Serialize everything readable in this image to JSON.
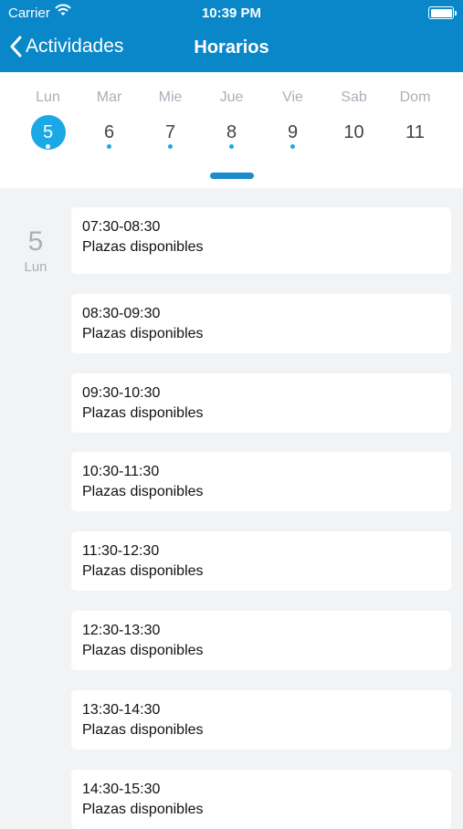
{
  "status": {
    "carrier": "Carrier",
    "time": "10:39 PM"
  },
  "nav": {
    "back_label": "Actividades",
    "title": "Horarios"
  },
  "week": {
    "accent": "#1aa9e6",
    "days": [
      {
        "name": "Lun",
        "num": "5",
        "selected": true,
        "dot": true
      },
      {
        "name": "Mar",
        "num": "6",
        "selected": false,
        "dot": true
      },
      {
        "name": "Mie",
        "num": "7",
        "selected": false,
        "dot": true
      },
      {
        "name": "Jue",
        "num": "8",
        "selected": false,
        "dot": true
      },
      {
        "name": "Vie",
        "num": "9",
        "selected": false,
        "dot": true
      },
      {
        "name": "Sab",
        "num": "10",
        "selected": false,
        "dot": false
      },
      {
        "name": "Dom",
        "num": "11",
        "selected": false,
        "dot": false
      }
    ]
  },
  "schedule": {
    "day_number": "5",
    "day_name": "Lun",
    "slots": [
      {
        "time": "07:30-08:30",
        "status": "Plazas disponibles"
      },
      {
        "time": "08:30-09:30",
        "status": "Plazas disponibles"
      },
      {
        "time": "09:30-10:30",
        "status": "Plazas disponibles"
      },
      {
        "time": "10:30-11:30",
        "status": "Plazas disponibles"
      },
      {
        "time": "11:30-12:30",
        "status": "Plazas disponibles"
      },
      {
        "time": "12:30-13:30",
        "status": "Plazas disponibles"
      },
      {
        "time": "13:30-14:30",
        "status": "Plazas disponibles"
      },
      {
        "time": "14:30-15:30",
        "status": "Plazas disponibles"
      }
    ]
  }
}
